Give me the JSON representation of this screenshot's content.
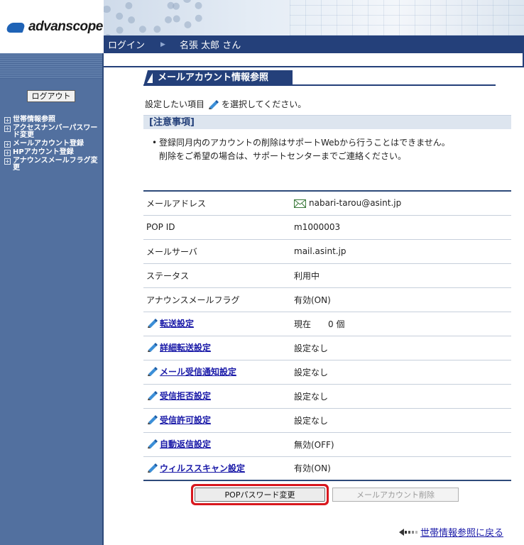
{
  "header": {
    "logo_text": "advanscope",
    "login_label": "ログイン",
    "separator": "▶",
    "user_name": "名張 太郎 さん"
  },
  "sidebar": {
    "logout_label": "ログアウト",
    "items": [
      {
        "label": "世帯情報参照"
      },
      {
        "label": "アクセスナンバーパスワード変更"
      },
      {
        "label": "メールアカウント登録"
      },
      {
        "label": "HPアカウント登録"
      },
      {
        "label": "アナウンスメールフラグ変更"
      }
    ]
  },
  "main": {
    "section_title": "メールアカウント情報参照",
    "instruction_before": "設定したい項目",
    "instruction_after": "を選択してください。",
    "notice_title": "[注意事項]",
    "notice_bullet": "•",
    "notice_line1": "登録同月内のアカウントの削除はサポートWebから行うことはできません。",
    "notice_line2": "削除をご希望の場合は、サポートセンターまでご連絡ください。",
    "rows": [
      {
        "label": "メールアドレス",
        "value": "nabari-tarou@asint.jp"
      },
      {
        "label": "POP ID",
        "value": "m1000003"
      },
      {
        "label": "メールサーバ",
        "value": "mail.asint.jp"
      },
      {
        "label": "ステータス",
        "value": "利用中"
      },
      {
        "label": "アナウンスメールフラグ",
        "value": "有効(ON)"
      },
      {
        "label": "転送設定",
        "value": "現在　　0 個"
      },
      {
        "label": "詳細転送設定",
        "value": "設定なし"
      },
      {
        "label": "メール受信通知設定",
        "value": "設定なし"
      },
      {
        "label": "受信拒否設定",
        "value": "設定なし"
      },
      {
        "label": "受信許可設定",
        "value": "設定なし"
      },
      {
        "label": "自動返信設定",
        "value": "無効(OFF)"
      },
      {
        "label": "ウィルススキャン設定",
        "value": "有効(ON)"
      }
    ],
    "pop_password_button": "POPパスワード変更",
    "delete_button": "メールアカウント削除",
    "back_link": "世帯情報参照に戻る"
  },
  "colors": {
    "navy": "#24407a",
    "sidebar": "#52709f",
    "link": "#1a1aa8",
    "highlight": "#d8181e"
  }
}
